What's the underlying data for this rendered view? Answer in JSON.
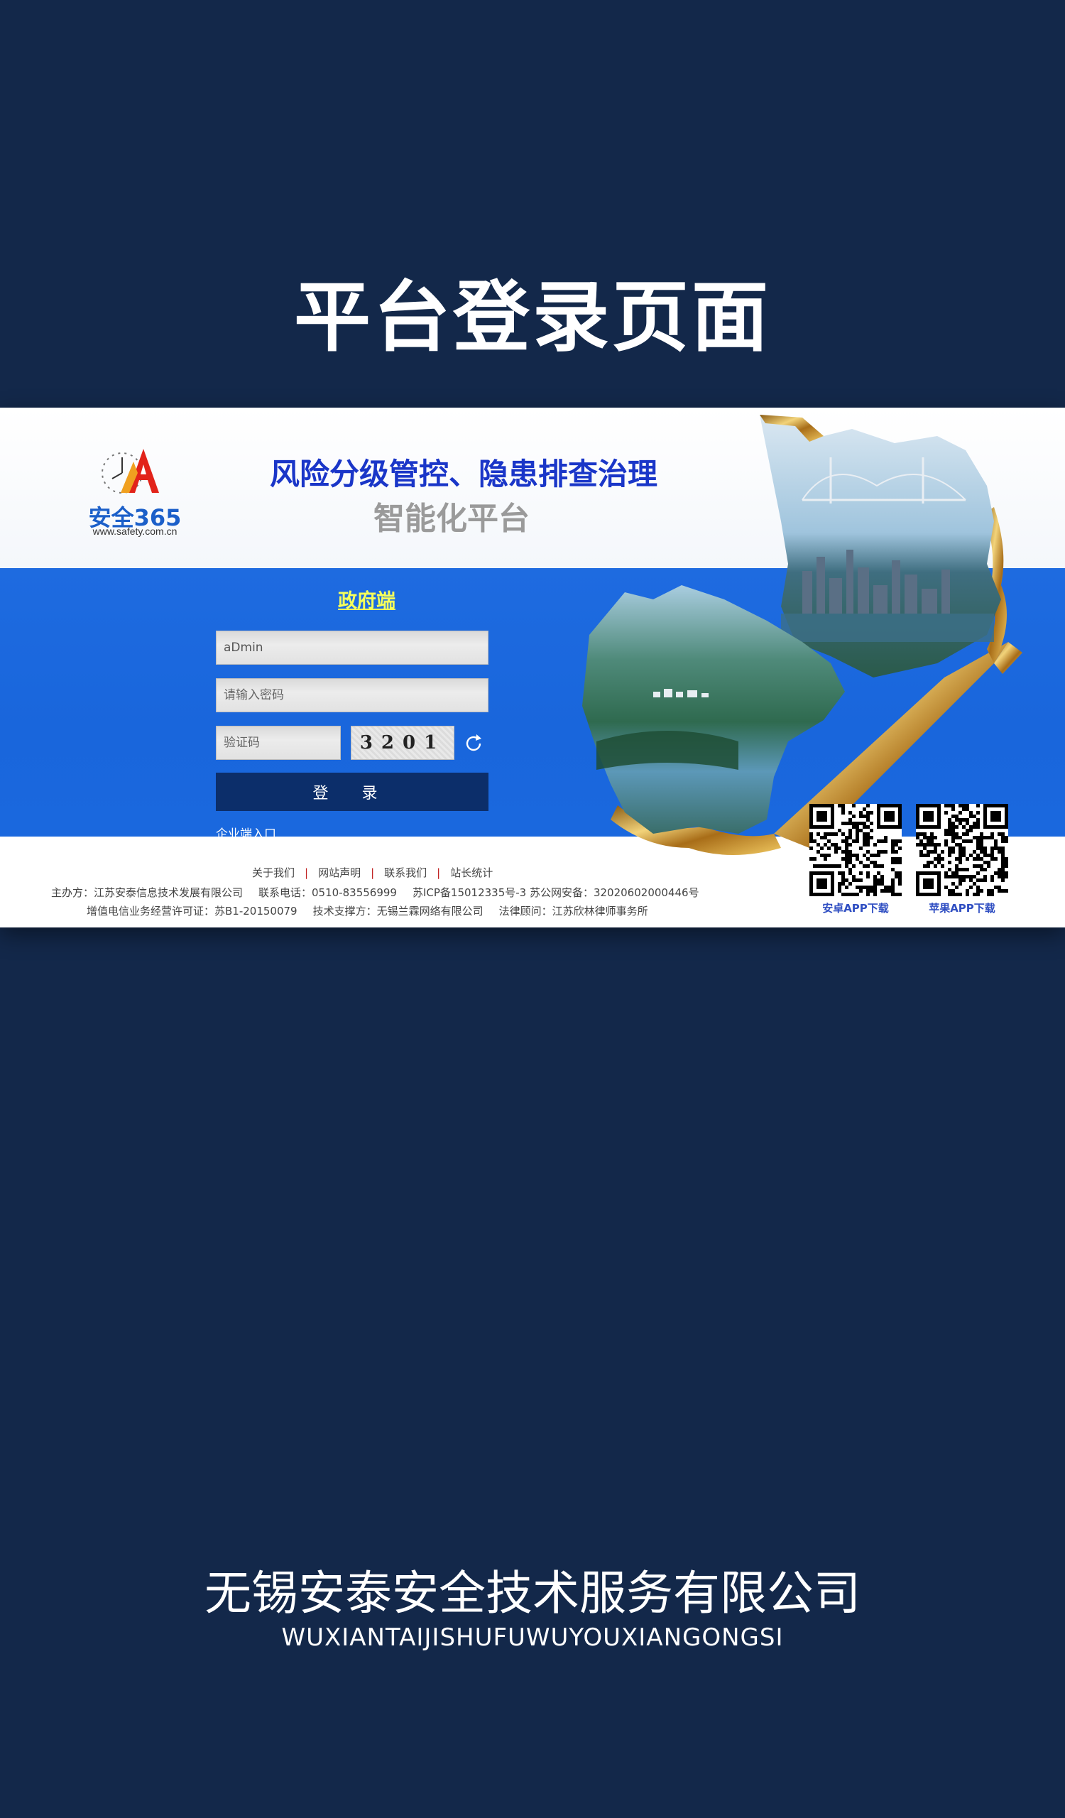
{
  "page": {
    "heading": "平台登录页面",
    "background_color": "#13284a"
  },
  "screenshot": {
    "logo": {
      "name": "安全365",
      "url": "www.safety.com.cn",
      "icon": "clock-a-logo-icon"
    },
    "headline": {
      "line1": "风险分级管控、隐患排查治理",
      "line2": "智能化平台"
    },
    "login": {
      "portal_title": "政府端",
      "username_value": "aDmin",
      "password_placeholder": "请输入密码",
      "captcha_placeholder": "验证码",
      "captcha_code": "3201",
      "refresh_icon": "refresh-icon",
      "submit_label": "登 录",
      "enterprise_link": "企业端入口"
    },
    "footer": {
      "links": [
        "关于我们",
        "网站声明",
        "联系我们",
        "站长统计"
      ],
      "line1": {
        "host": "主办方：江苏安泰信息技术发展有限公司",
        "phone": "联系电话：0510-83556999",
        "icp": "苏ICP备15012335号-3 苏公网安备：32020602000446号"
      },
      "line2": {
        "license": "增值电信业务经营许可证：苏B1-20150079",
        "support": "技术支撑方：无锡兰霖网络有限公司",
        "legal": "法律顾问：江苏欣林律师事务所"
      }
    },
    "apps": {
      "android_label": "安卓APP下载",
      "ios_label": "苹果APP下载"
    },
    "colors": {
      "blue_band": "#1966dc",
      "login_button": "#0c2e6a",
      "portal_title": "#f5ff5b",
      "headline": "#1a36c8"
    }
  },
  "company": {
    "name": "无锡安泰安全技术服务有限公司",
    "pinyin": "WUXIANTAIJISHUFUWUYOUXIANGONGSI"
  }
}
